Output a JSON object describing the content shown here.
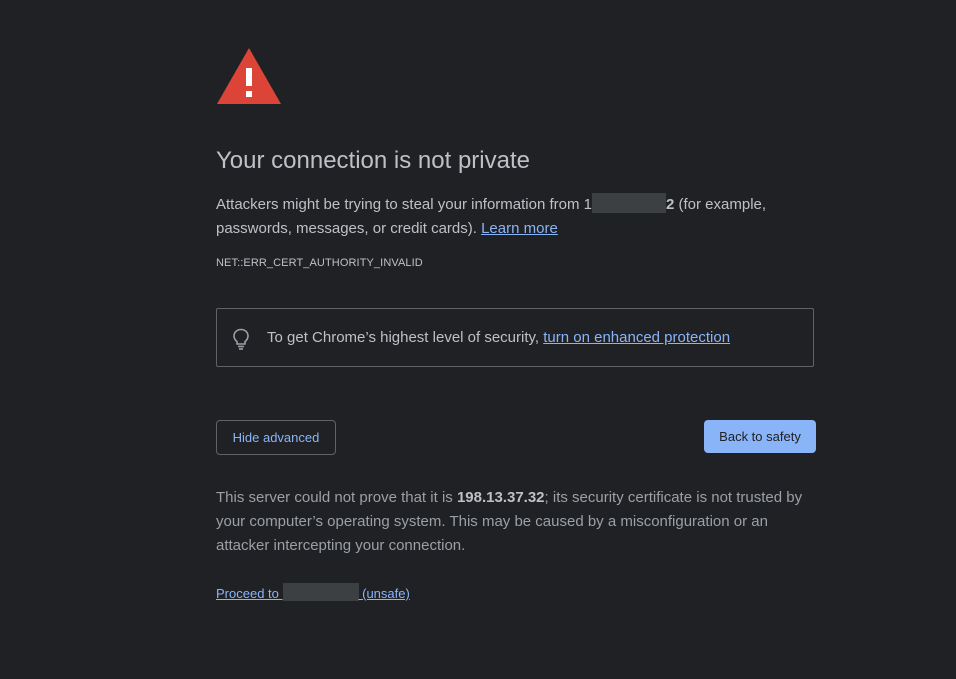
{
  "page": {
    "title": "Your connection is not private",
    "main_message": {
      "prefix": "Attackers might be trying to steal your information from ",
      "host_start": "1",
      "host_end": "2",
      "suffix": " (for example, passwords, messages, or credit cards). ",
      "learn_more": "Learn more"
    },
    "error_code": "NET::ERR_CERT_AUTHORITY_INVALID",
    "enhanced": {
      "text": "To get Chrome’s highest level of security, ",
      "link": "turn on enhanced protection"
    },
    "buttons": {
      "hide_advanced": "Hide advanced",
      "back_to_safety": "Back to safety"
    },
    "details": {
      "prefix": "This server could not prove that it is ",
      "host": "198.13.37.32",
      "suffix": "; its security certificate is not trusted by your computer’s operating system. This may be caused by a misconfiguration or an attacker intercepting your connection."
    },
    "proceed": {
      "prefix": "Proceed to ",
      "suffix": " (unsafe)"
    }
  },
  "colors": {
    "background": "#202124",
    "warning_red": "#db4437",
    "link_blue": "#8ab4f8",
    "text": "#bdc1c6"
  },
  "icons": {
    "warning": "warning-triangle-icon",
    "bulb": "lightbulb-icon"
  }
}
